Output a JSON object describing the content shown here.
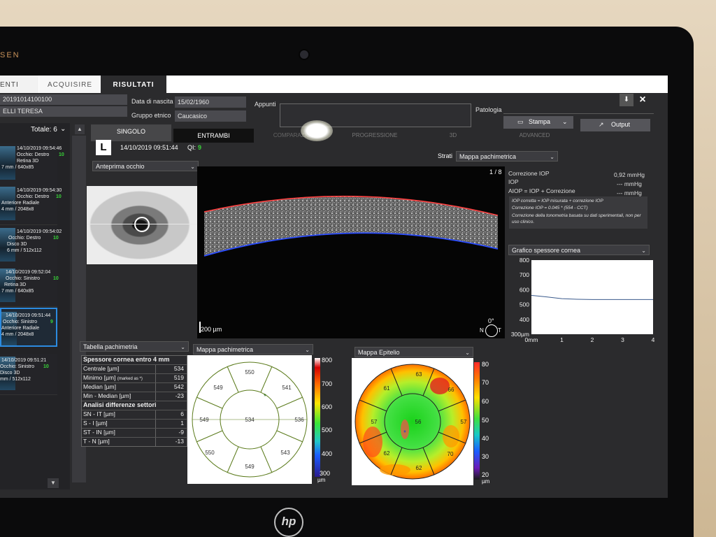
{
  "device": {
    "brand_partial": "SEN",
    "monitor_logo": "hp"
  },
  "app": {
    "tabs": [
      {
        "label": "ENTI"
      },
      {
        "label": "ACQUISIRE"
      },
      {
        "label": "RISULTATI"
      }
    ],
    "close_label": "×"
  },
  "patient": {
    "id_partial": "20191014100100",
    "name_partial": "ELLI TERESA",
    "birth_label": "Data di nascita",
    "birth_value": "15/02/1960",
    "ethnic_label": "Gruppo etnico",
    "ethnic_value": "Caucasico",
    "notes_label": "Appunti",
    "pathology_label": "Patologia"
  },
  "actions": {
    "print_label": "Stampa",
    "output_label": "Output"
  },
  "scan_list": {
    "total_label": "Totale: 6",
    "items": [
      {
        "time": "14/10/2019 09:54:46",
        "eye": "Occhio: Destro",
        "type": "Retina 3D",
        "size": "7 mm / 640x85",
        "qi": "10"
      },
      {
        "time": "14/10/2019 09:54:30",
        "eye": "Occhio: Destro",
        "type": "Anteriore Radiale",
        "size": "4 mm / 2048x8",
        "qi": "10"
      },
      {
        "time": "14/10/2019 09:54:02",
        "eye": "Occhio: Destro",
        "type": "Disco 3D",
        "size": "6 mm / 512x112",
        "qi": "10"
      },
      {
        "time": "14/10/2019 09:52:04",
        "eye": "Occhio: Sinistro",
        "type": "Retina 3D",
        "size": "7 mm / 640x85",
        "qi": "10"
      },
      {
        "time": "14/10/2019 09:51:44",
        "eye": "Occhio: Sinistro",
        "type": "Anteriore Radiale",
        "size": "4 mm / 2048x8",
        "qi": "9"
      },
      {
        "time": "14/10/2019 09:51:21",
        "eye": "Occhio: Sinistro",
        "type": "Disco 3D",
        "size": "mm / 512x112",
        "qi": "10"
      }
    ]
  },
  "view_tabs": {
    "singolo": "SINGOLO",
    "entrambi": "ENTRAMBI",
    "comparison": "COMPARAZIONE",
    "progressione": "PROGRESSIONE",
    "td": "3D",
    "advanced": "ADVANCED"
  },
  "scan_header": {
    "eye": "L",
    "datetime": "14/10/2019 09:51:44",
    "qi_label": "QI:",
    "qi_value": "9"
  },
  "strati": {
    "label": "Strati",
    "value": "Mappa pachimetrica"
  },
  "preview": {
    "label": "Anteprima occhio"
  },
  "bscan": {
    "counter": "1 / 8",
    "scale": "200 µm",
    "orient_deg": "0°",
    "orient_n": "N",
    "orient_t": "T"
  },
  "iop": {
    "correction_label": "Correzione IOP",
    "correction_value": "0,92 mmHg",
    "iop_label": "IOP",
    "iop_value": "--- mmHg",
    "aiop_label": "AIOP = IOP + Correzione",
    "aiop_value": "--- mmHg",
    "note1": "IOP corretta = IOP misurata + correzione IOP",
    "note2": "Correzione IOP = 0.045 * (554 - CCT)",
    "note3": "Correzione della tonometria basata su dati sperimentali, non per uso clinico."
  },
  "thickness_chart_panel": {
    "label": "Grafico spessore cornea"
  },
  "chart_data": {
    "type": "line",
    "title": "Grafico spessore cornea",
    "xlabel": "",
    "ylabel": "",
    "x_tick_labels": [
      "0mm",
      "1",
      "2",
      "3",
      "4"
    ],
    "y_tick_labels": [
      "300µm",
      "400",
      "500",
      "600",
      "700",
      "800"
    ],
    "ylim": [
      300,
      800
    ],
    "xlim": [
      0,
      4
    ],
    "x": [
      0,
      0.25,
      0.5,
      0.75,
      1,
      1.5,
      2,
      2.5,
      3,
      3.5,
      4
    ],
    "series": [
      {
        "values": [
          562,
          557,
          552,
          546,
          540,
          536,
          534,
          534,
          534,
          534,
          534
        ]
      }
    ],
    "grid": false
  },
  "pachy_table": {
    "title": "Tabella pachimetria",
    "header": "Spessore cornea entro 4 mm",
    "rows": [
      {
        "k": "Centrale [µm]",
        "v": "534"
      },
      {
        "k": "Minimo [µm]",
        "note": "(marked as *)",
        "v": "519"
      },
      {
        "k": "Median [µm]",
        "v": "542"
      },
      {
        "k": "Min - Median [µm]",
        "v": "-23"
      }
    ],
    "sector_header": "Analisi differenze settori",
    "sector_rows": [
      {
        "k": "SN - IT [µm]",
        "v": "6"
      },
      {
        "k": "S - I [µm]",
        "v": "1"
      },
      {
        "k": "ST - IN [µm]",
        "v": "-9"
      },
      {
        "k": "T - N [µm]",
        "v": "-13"
      }
    ]
  },
  "pachy_map": {
    "title": "Mappa pachimetrica",
    "center": "534",
    "sectors": [
      "550",
      "541",
      "536",
      "543",
      "549",
      "550",
      "549",
      "549"
    ],
    "scale": [
      "800",
      "700",
      "600",
      "500",
      "400",
      "300"
    ],
    "scale_unit": "µm",
    "min_marker": "*"
  },
  "epi_map": {
    "title": "Mappa Epitelio",
    "center": "56",
    "sectors": [
      "63",
      "66",
      "57",
      "70",
      "62",
      "62",
      "57",
      "61"
    ],
    "scale": [
      "80",
      "70",
      "60",
      "50",
      "40",
      "30",
      "20"
    ],
    "scale_unit": "µm",
    "min_marker": "*"
  },
  "colors": {
    "accent_green": "#38d538",
    "panel": "#2b2b2d",
    "anterior_red": "#ff4040",
    "posterior_blue": "#2a4cff"
  }
}
